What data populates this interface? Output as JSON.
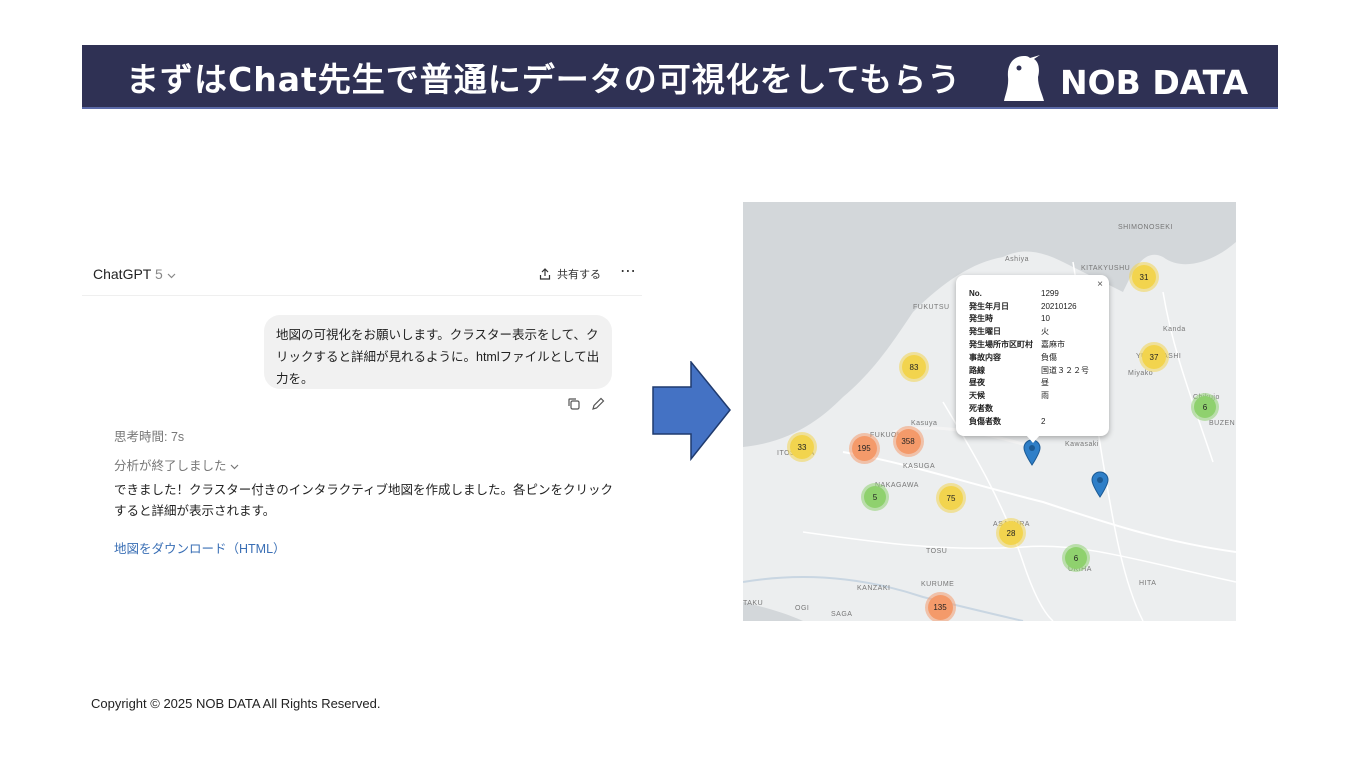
{
  "banner": {
    "title": "まずはChat先生で普通にデータの可視化をしてもらう",
    "logo_text": "NOB DATA"
  },
  "chat": {
    "model_name": "ChatGPT",
    "model_version": "5",
    "share_label": "共有する",
    "user_message": "地図の可視化をお願いします。クラスター表示をして、クリックすると詳細が見れるように。htmlファイルとして出力を。",
    "thinking_time": "思考時間: 7s",
    "analysis_label": "分析が終了しました",
    "answer": "できました！クラスター付きのインタラクティブ地図を作成しました。各ピンをクリックすると詳細が表示されます。",
    "download_link": "地図をダウンロード（HTML）"
  },
  "map": {
    "popup": {
      "close": "×",
      "rows": [
        {
          "key": "No.",
          "value": "1299"
        },
        {
          "key": "発生年月日",
          "value": "20210126"
        },
        {
          "key": "発生時",
          "value": "10"
        },
        {
          "key": "発生曜日",
          "value": "火"
        },
        {
          "key": "発生場所市区町村",
          "value": "嘉麻市"
        },
        {
          "key": "事故内容",
          "value": "負傷"
        },
        {
          "key": "路線",
          "value": "国道３２２号"
        },
        {
          "key": "昼夜",
          "value": "昼"
        },
        {
          "key": "天候",
          "value": "雨"
        },
        {
          "key": "死者数",
          "value": ""
        },
        {
          "key": "負傷者数",
          "value": "2"
        }
      ]
    },
    "clusters": [
      {
        "count": "31",
        "level": "medium"
      },
      {
        "count": "37",
        "level": "medium"
      },
      {
        "count": "83",
        "level": "medium"
      },
      {
        "count": "6",
        "level": "small"
      },
      {
        "count": "33",
        "level": "medium"
      },
      {
        "count": "195",
        "level": "large"
      },
      {
        "count": "358",
        "level": "large"
      },
      {
        "count": "5",
        "level": "small"
      },
      {
        "count": "75",
        "level": "medium"
      },
      {
        "count": "28",
        "level": "medium"
      },
      {
        "count": "6",
        "level": "small"
      },
      {
        "count": "135",
        "level": "large"
      }
    ],
    "place_labels": [
      "SHIMONOSEKI",
      "KITAKYUSHU",
      "Ashiya",
      "FUKUTSU",
      "Kanda",
      "YUKUHASHI",
      "Miyako",
      "Chikujo",
      "BUZEN",
      "Kasuya",
      "FUKUOKA",
      "ITOSHIMA",
      "Kawasaki",
      "KASUGA",
      "NAKAGAWA",
      "ASAKURA",
      "TOSU",
      "UKIHA",
      "HITA",
      "KANZAKI",
      "KURUME",
      "TAKU",
      "OGI",
      "SAGA"
    ],
    "colors": {
      "small": "#8fd16e",
      "medium": "#f2d44e",
      "large": "#f49a6a",
      "pin": "#2f7fc8"
    }
  },
  "footer": {
    "copyright": "Copyright © 2025 NOB DATA All Rights Reserved."
  }
}
